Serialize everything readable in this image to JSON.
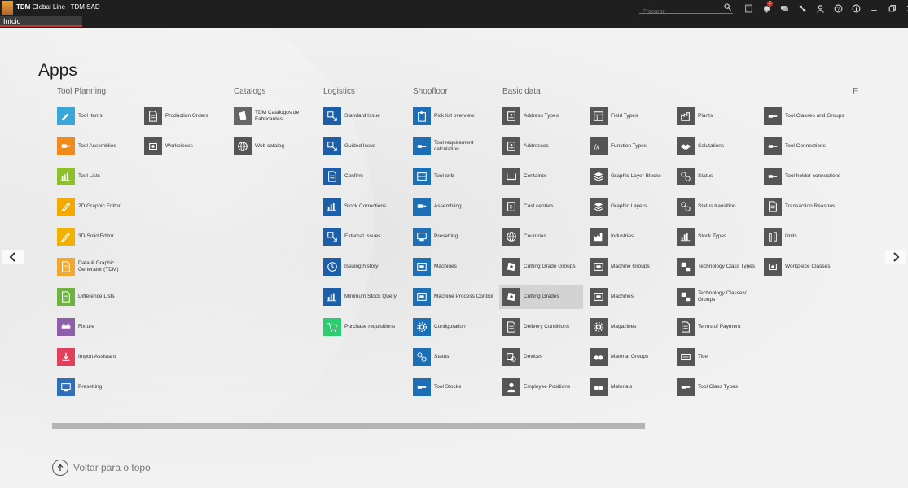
{
  "app": {
    "brand": "TDM",
    "title": "Global Line",
    "subtitle": "TDM SAD"
  },
  "search": {
    "placeholder": "Procurar"
  },
  "toolbar_icons": [
    "save-icon",
    "notifications-icon",
    "chat-icon",
    "connections-icon",
    "user-icon",
    "help-icon",
    "info-icon",
    "minimize-icon",
    "restore-icon",
    "close-icon"
  ],
  "notification_count": "2",
  "tab": {
    "label": "Início"
  },
  "page_title": "Apps",
  "columns": [
    "Tool Planning",
    "Catalogs",
    "Logistics",
    "Shopfloor",
    "Basic data",
    "F"
  ],
  "back_to_top": "Voltar para o topo",
  "groups": [
    {
      "items": [
        {
          "label": "Tool Items",
          "color": "#3aa6d8",
          "icon": "pen-icon"
        },
        {
          "label": "Tool Assemblies",
          "color": "#f08a1c",
          "icon": "assembly-icon"
        },
        {
          "label": "Tool Lists",
          "color": "#8dbf2e",
          "icon": "list-chart-icon"
        },
        {
          "label": "2D Graphic Editor",
          "color": "#f2a900",
          "icon": "pencil-icon"
        },
        {
          "label": "3D-Solid Editor",
          "color": "#f2b100",
          "icon": "pencil-icon"
        },
        {
          "label": "Data & Graphic Generator (TDM)",
          "color": "#f0a830",
          "icon": "document-icon"
        },
        {
          "label": "Difference Lists",
          "color": "#6db33f",
          "icon": "document-icon"
        },
        {
          "label": "Fixture",
          "color": "#8e5fa8",
          "icon": "fixture-icon"
        },
        {
          "label": "Import Assistant",
          "color": "#e0405a",
          "icon": "import-icon"
        },
        {
          "label": "Presetting",
          "color": "#2f6fb7",
          "icon": "presetting-icon"
        }
      ]
    },
    {
      "items": [
        {
          "label": "Production Orders",
          "color": "#555555",
          "icon": "document-icon"
        },
        {
          "label": "Workpieces",
          "color": "#555555",
          "icon": "workpiece-icon"
        }
      ]
    },
    {
      "items": [
        {
          "label": "TDM Catálogos de Fabricantes",
          "color": "#666666",
          "icon": "catalog-icon"
        },
        {
          "label": "Web catalog",
          "color": "#555555",
          "icon": "globe-icon"
        }
      ]
    },
    {
      "items": [
        {
          "label": "Standard Issue",
          "color": "#1c5fa8",
          "icon": "issue-icon"
        },
        {
          "label": "Guided Issue",
          "color": "#1c5fa8",
          "icon": "issue-icon"
        },
        {
          "label": "Confirm",
          "color": "#1c5fa8",
          "icon": "document-icon"
        },
        {
          "label": "Stock Corrections",
          "color": "#1c5fa8",
          "icon": "list-chart-icon"
        },
        {
          "label": "External Issues",
          "color": "#1c5fa8",
          "icon": "issue-icon"
        },
        {
          "label": "Issuing history",
          "color": "#1c5fa8",
          "icon": "history-icon"
        },
        {
          "label": "Minimum Stock Query",
          "color": "#1c5fa8",
          "icon": "list-chart-icon"
        },
        {
          "label": "Purchase requisitions",
          "color": "#2ecc71",
          "icon": "cart-icon"
        }
      ]
    },
    {
      "items": [
        {
          "label": "Pick list overview",
          "color": "#1c6fb7",
          "icon": "clipboard-icon"
        },
        {
          "label": "Tool requirement calculation",
          "color": "#1c6fb7",
          "icon": "tool-icon"
        },
        {
          "label": "Tool crib",
          "color": "#1c6fb7",
          "icon": "crib-icon"
        },
        {
          "label": "Assembling",
          "color": "#1c6fb7",
          "icon": "assembly-icon"
        },
        {
          "label": "Presetting",
          "color": "#1c6fb7",
          "icon": "presetting-icon"
        },
        {
          "label": "Machines",
          "color": "#1c6fb7",
          "icon": "machine-icon"
        },
        {
          "label": "Machine Process Control",
          "color": "#1c6fb7",
          "icon": "machine-icon"
        },
        {
          "label": "Configuration",
          "color": "#1c6fb7",
          "icon": "gear-icon"
        },
        {
          "label": "Status",
          "color": "#1c6fb7",
          "icon": "status-icon"
        },
        {
          "label": "Tool Stocks",
          "color": "#1c6fb7",
          "icon": "tool-icon"
        }
      ]
    },
    {
      "items": [
        {
          "label": "Address Types",
          "color": "#555555",
          "icon": "address-icon"
        },
        {
          "label": "Addresses",
          "color": "#555555",
          "icon": "address-icon"
        },
        {
          "label": "Container",
          "color": "#555555",
          "icon": "container-icon"
        },
        {
          "label": "Cost centers",
          "color": "#555555",
          "icon": "cost-icon"
        },
        {
          "label": "Countries",
          "color": "#555555",
          "icon": "globe-icon"
        },
        {
          "label": "Cutting Grade Groups",
          "color": "#555555",
          "icon": "grade-icon"
        },
        {
          "label": "Cutting Grades",
          "color": "#555555",
          "icon": "grade-icon",
          "selected": true
        },
        {
          "label": "Delivery Conditions",
          "color": "#555555",
          "icon": "document-icon"
        },
        {
          "label": "Devices",
          "color": "#555555",
          "icon": "device-icon"
        },
        {
          "label": "Employee Positions",
          "color": "#555555",
          "icon": "user-icon"
        }
      ]
    },
    {
      "items": [
        {
          "label": "Field Types",
          "color": "#555555",
          "icon": "field-icon"
        },
        {
          "label": "Function Types",
          "color": "#555555",
          "icon": "function-icon"
        },
        {
          "label": "Graphic Layer Blocks",
          "color": "#555555",
          "icon": "layers-icon"
        },
        {
          "label": "Graphic Layers",
          "color": "#555555",
          "icon": "layers-icon"
        },
        {
          "label": "Industries",
          "color": "#555555",
          "icon": "industry-icon"
        },
        {
          "label": "Machine Groups",
          "color": "#555555",
          "icon": "machine-icon"
        },
        {
          "label": "Machines",
          "color": "#555555",
          "icon": "machine-icon"
        },
        {
          "label": "Magazines",
          "color": "#555555",
          "icon": "gear-icon"
        },
        {
          "label": "Material Groups",
          "color": "#555555",
          "icon": "material-icon"
        },
        {
          "label": "Materials",
          "color": "#555555",
          "icon": "material-icon"
        }
      ]
    },
    {
      "items": [
        {
          "label": "Plants",
          "color": "#555555",
          "icon": "plant-icon"
        },
        {
          "label": "Salutations",
          "color": "#555555",
          "icon": "handshake-icon"
        },
        {
          "label": "Status",
          "color": "#555555",
          "icon": "status-icon"
        },
        {
          "label": "Status transition",
          "color": "#555555",
          "icon": "status-icon"
        },
        {
          "label": "Stock Types",
          "color": "#555555",
          "icon": "list-chart-icon"
        },
        {
          "label": "Technology Class Types",
          "color": "#555555",
          "icon": "tech-icon"
        },
        {
          "label": "Technology Classes/ Groups",
          "color": "#555555",
          "icon": "tech-icon"
        },
        {
          "label": "Terms of Payment",
          "color": "#555555",
          "icon": "document-icon"
        },
        {
          "label": "Title",
          "color": "#555555",
          "icon": "title-icon"
        },
        {
          "label": "Tool Class Types",
          "color": "#555555",
          "icon": "tool-icon"
        }
      ]
    },
    {
      "items": [
        {
          "label": "Tool Classes and Groups",
          "color": "#555555",
          "icon": "tool-icon"
        },
        {
          "label": "Tool Connections",
          "color": "#555555",
          "icon": "tool-icon"
        },
        {
          "label": "Tool holder connections",
          "color": "#555555",
          "icon": "tool-icon"
        },
        {
          "label": "Transaction Reasons",
          "color": "#555555",
          "icon": "document-icon"
        },
        {
          "label": "Units",
          "color": "#555555",
          "icon": "units-icon"
        },
        {
          "label": "Workpiece Classes",
          "color": "#555555",
          "icon": "workpiece-icon"
        }
      ]
    }
  ]
}
